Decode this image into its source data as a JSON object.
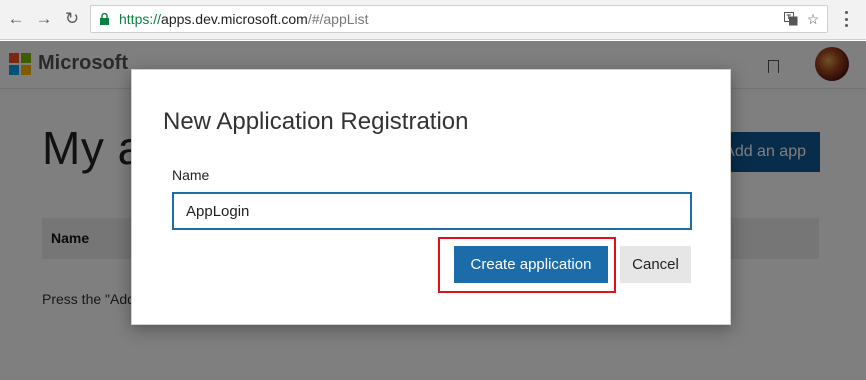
{
  "browser": {
    "url_scheme": "https://",
    "url_host": "apps.dev.microsoft.com",
    "url_path": "/#/appList"
  },
  "header": {
    "brand": "Microsoft",
    "logo_colors": [
      "#f25022",
      "#7fba00",
      "#00a4ef",
      "#ffb900"
    ]
  },
  "page": {
    "title": "My apps",
    "add_app_label": "Add an app",
    "table_header_name": "Name",
    "hint": "Press the \"Add an app\""
  },
  "modal": {
    "title": "New Application Registration",
    "name_label": "Name",
    "name_value": "AppLogin",
    "create_label": "Create application",
    "cancel_label": "Cancel"
  },
  "colors": {
    "primary_button": "#1b6ca8",
    "highlight_border": "#e0101a"
  }
}
